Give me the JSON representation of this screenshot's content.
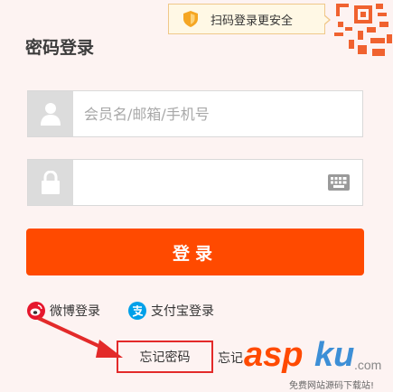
{
  "qr_tip": {
    "text": "扫码登录更安全"
  },
  "title": "密码登录",
  "username": {
    "placeholder": "会员名/邮箱/手机号",
    "value": ""
  },
  "password": {
    "placeholder": "",
    "value": ""
  },
  "login_button": "登录",
  "social": {
    "weibo": "微博登录",
    "alipay": "支付宝登录"
  },
  "links": {
    "forgot_password": "忘记密码",
    "forgot_password_partial": "忘记"
  },
  "watermark": {
    "asp": "asp",
    "ku": "ku",
    "com": ".com",
    "subtitle": "免费网站源码下载站!"
  },
  "colors": {
    "accent": "#ff4a00",
    "annotation": "#e32a2a",
    "tip_border": "#f0c88a",
    "tip_bg": "#fff8e5"
  }
}
